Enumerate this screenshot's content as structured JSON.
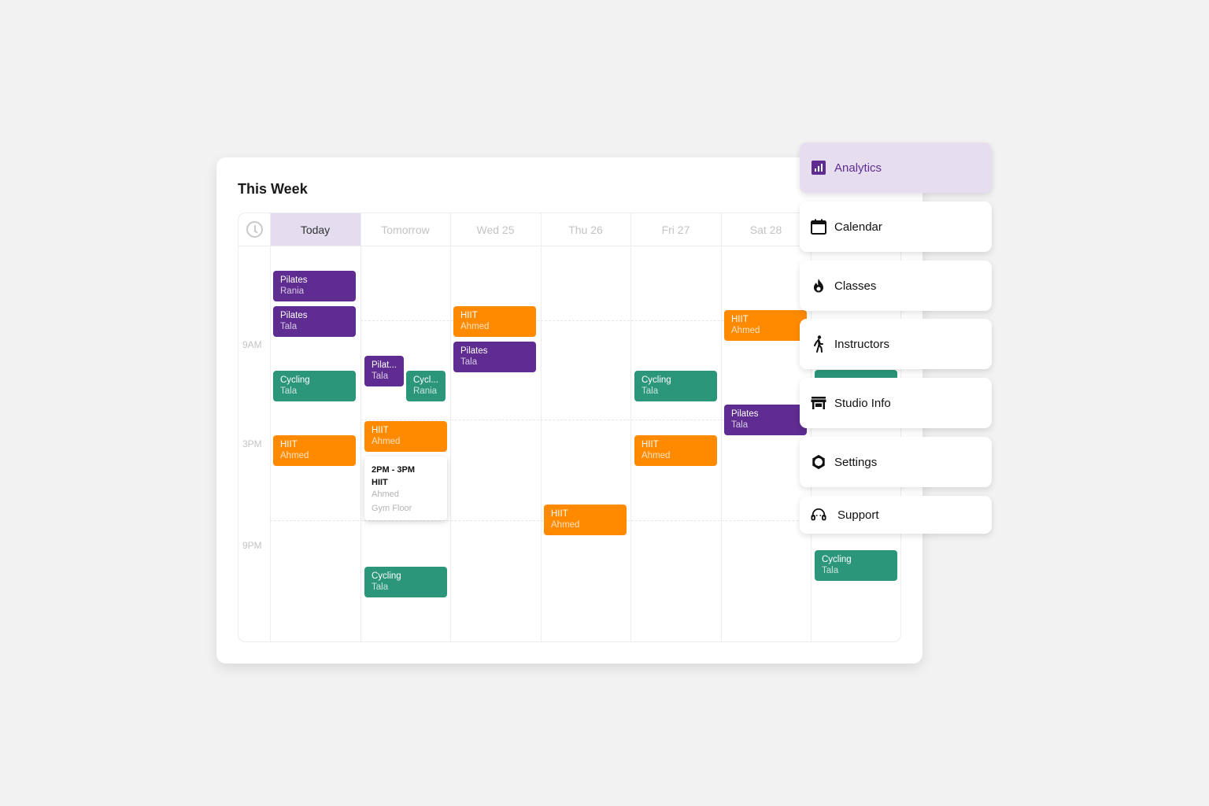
{
  "schedule": {
    "title": "This Week",
    "days": [
      "Today",
      "Tomorrow",
      "Wed 25",
      "Thu 26",
      "Fri 27",
      "Sat 28"
    ],
    "times": [
      "9AM",
      "3PM",
      "9PM"
    ],
    "events": [
      {
        "name": "Pilates",
        "instructor": "Rania"
      },
      {
        "name": "Pilates",
        "instructor": "Tala"
      },
      {
        "name": "Cycling",
        "instructor": "Tala"
      },
      {
        "name": "HIIT",
        "instructor": "Ahmed"
      },
      {
        "name": "Pilat...",
        "instructor": "Tala"
      },
      {
        "name": "Cycl...",
        "instructor": "Rania"
      },
      {
        "name": "HIIT",
        "instructor": "Ahmed"
      },
      {
        "name": "Cycling",
        "instructor": "Tala"
      },
      {
        "name": "HIIT",
        "instructor": "Ahmed"
      },
      {
        "name": "Pilates",
        "instructor": "Tala"
      },
      {
        "name": "HIIT",
        "instructor": "Ahmed"
      },
      {
        "name": "Cycling",
        "instructor": "Tala"
      },
      {
        "name": "HIIT",
        "instructor": "Ahmed"
      },
      {
        "name": "HIIT",
        "instructor": "Ahmed"
      },
      {
        "name": "Pilates",
        "instructor": "Tala"
      },
      {
        "name": "Cycling",
        "instructor": "Tala"
      }
    ],
    "popup": {
      "time": "2PM - 3PM",
      "class": "HIIT",
      "instructor": "Ahmed",
      "location": "Gym Floor"
    }
  },
  "menu": {
    "items": [
      {
        "label": "Analytics",
        "icon": "analytics-icon"
      },
      {
        "label": "Calendar",
        "icon": "calendar-icon"
      },
      {
        "label": "Classes",
        "icon": "flame-icon"
      },
      {
        "label": "Instructors",
        "icon": "walking-person-icon"
      },
      {
        "label": "Studio Info",
        "icon": "storefront-icon"
      },
      {
        "label": "Settings",
        "icon": "gear-icon"
      },
      {
        "label": "Support",
        "icon": "headset-icon"
      }
    ]
  },
  "colors": {
    "pilates": "#5f2c91",
    "cycling": "#2b9679",
    "hiit": "#ff8a00",
    "accent": "#5f2c91",
    "today_highlight": "#e4dcef"
  }
}
